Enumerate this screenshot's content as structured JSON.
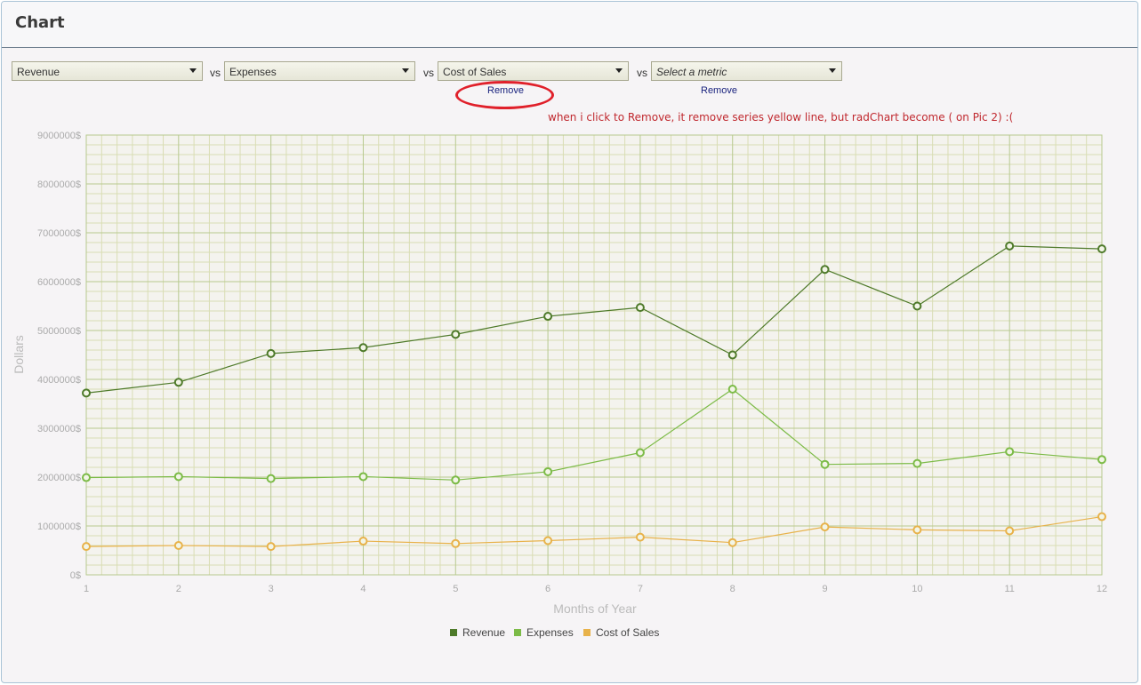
{
  "panel": {
    "title": "Chart"
  },
  "selectors": [
    {
      "value": "Revenue",
      "placeholder": false
    },
    {
      "value": "Expenses",
      "placeholder": false
    },
    {
      "value": "Cost of Sales",
      "placeholder": false
    },
    {
      "value": "Select a metric",
      "placeholder": true
    }
  ],
  "vs_label": "vs",
  "remove_label": "Remove",
  "annotation": "when i click to Remove, it remove series yellow line, but radChart become ( on Pic 2) :(",
  "colors": {
    "grid_major": "#b7c98f",
    "grid_minor": "#d9ddb4",
    "revenue": "#4e7a2a",
    "expenses": "#7cbb47",
    "cost_of_sales": "#e8b24a",
    "highlight": "#e0202a"
  },
  "chart_data": {
    "type": "line",
    "xlabel": "Months of Year",
    "ylabel": "Dollars",
    "x": [
      1,
      2,
      3,
      4,
      5,
      6,
      7,
      8,
      9,
      10,
      11,
      12
    ],
    "ylim": [
      0,
      9000000
    ],
    "y_ticks": [
      {
        "value": 0,
        "label": "0$"
      },
      {
        "value": 1000000,
        "label": "1000000$"
      },
      {
        "value": 2000000,
        "label": "2000000$"
      },
      {
        "value": 3000000,
        "label": "3000000$"
      },
      {
        "value": 4000000,
        "label": "4000000$"
      },
      {
        "value": 5000000,
        "label": "5000000$"
      },
      {
        "value": 6000000,
        "label": "6000000$"
      },
      {
        "value": 7000000,
        "label": "7000000$"
      },
      {
        "value": 8000000,
        "label": "8000000$"
      },
      {
        "value": 9000000,
        "label": "9000000$"
      }
    ],
    "grid": true,
    "legend_position": "bottom-center",
    "series": [
      {
        "name": "Revenue",
        "color": "#4e7a2a",
        "values": [
          3720000,
          3940000,
          4530000,
          4650000,
          4920000,
          5290000,
          5470000,
          4500000,
          6250000,
          5500000,
          6730000,
          6670000
        ]
      },
      {
        "name": "Expenses",
        "color": "#7cbb47",
        "values": [
          1990000,
          2010000,
          1970000,
          2010000,
          1940000,
          2110000,
          2500000,
          3800000,
          2260000,
          2280000,
          2520000,
          2360000
        ]
      },
      {
        "name": "Cost of Sales",
        "color": "#e8b24a",
        "values": [
          580000,
          600000,
          580000,
          690000,
          640000,
          700000,
          770000,
          660000,
          980000,
          920000,
          900000,
          1190000
        ]
      }
    ]
  }
}
